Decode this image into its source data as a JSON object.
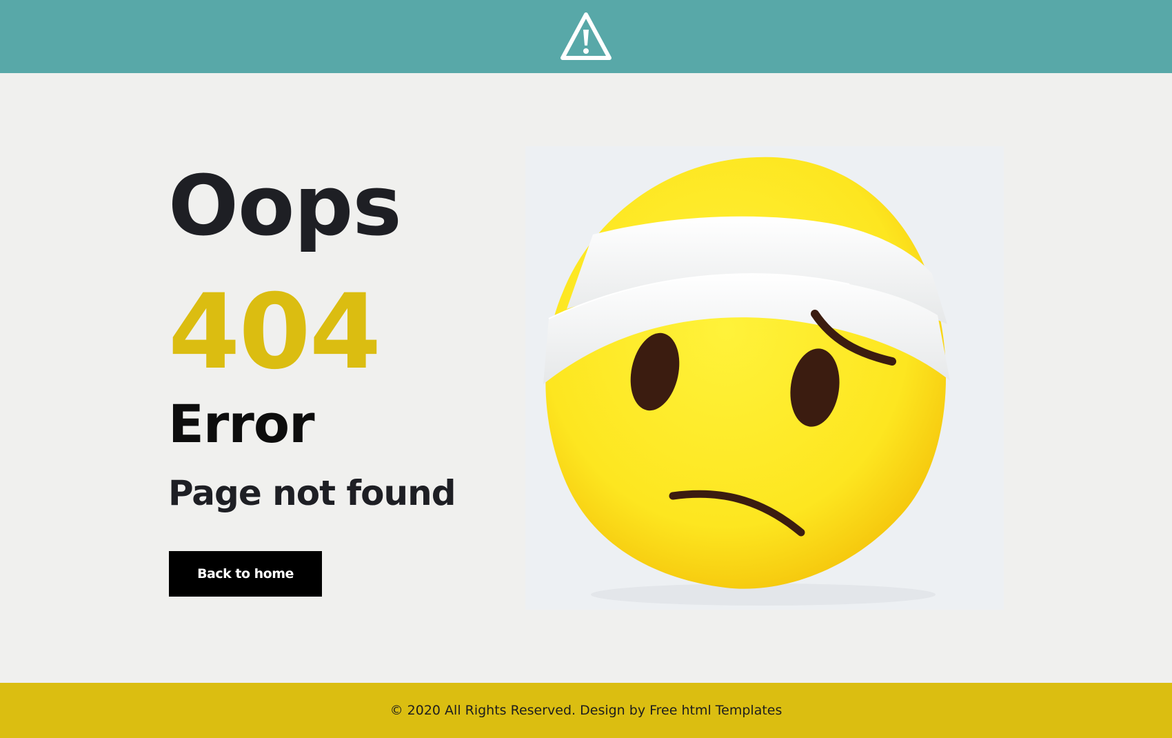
{
  "header": {
    "icon": "warning-triangle-icon",
    "background": "#58a8a8"
  },
  "hero": {
    "title": "Oops",
    "code": "404",
    "error_label": "Error",
    "subtitle": "Page not found",
    "button_label": "Back to home",
    "accent_color": "#dbbd11"
  },
  "image": {
    "subject": "sad-bandaged-emoji-pillow"
  },
  "footer": {
    "text": "© 2020 All Rights Reserved. Design by Free html Templates",
    "background": "#dbbe11"
  }
}
